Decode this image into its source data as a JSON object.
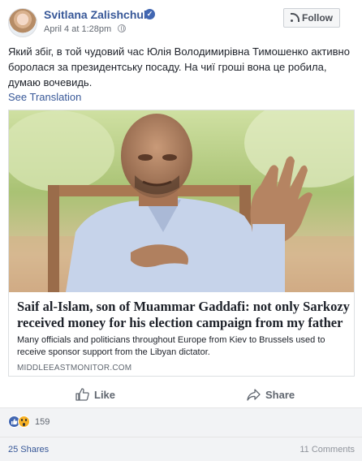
{
  "post": {
    "author": "Svitlana Zalishchuk",
    "date": "April 4 at 1:28pm",
    "follow_label": "Follow",
    "text": "Який збіг, в той чудовий час Юлія Володимирівна Тимошенко активно боролася за президентську посаду. На чиї гроші вона це робила, думаю вочевидь.",
    "see_translation": "See Translation"
  },
  "link": {
    "title": "Saif al-Islam, son of Muammar Gaddafi: not only Sarkozy received money for his election campaign from my father",
    "description": "Many officials and politicians throughout Europe from Kiev to Brussels used to receive sponsor support from the Libyan dictator.",
    "domain": "MIDDLEEASTMONITOR.COM"
  },
  "actions": {
    "like_label": "Like",
    "share_label": "Share"
  },
  "stats": {
    "reaction_count": "159",
    "shares": "25 Shares",
    "comments": "11 Comments"
  },
  "colors": {
    "link_blue": "#385898",
    "brand_blue": "#4267b2",
    "muted_gray": "#616770",
    "band_gray": "#f2f3f5"
  },
  "icons": [
    "verified-badge-icon",
    "globe-icon",
    "rss-icon",
    "thumbs-up-icon",
    "share-arrow-icon",
    "like-reaction-icon",
    "wow-reaction-icon"
  ]
}
